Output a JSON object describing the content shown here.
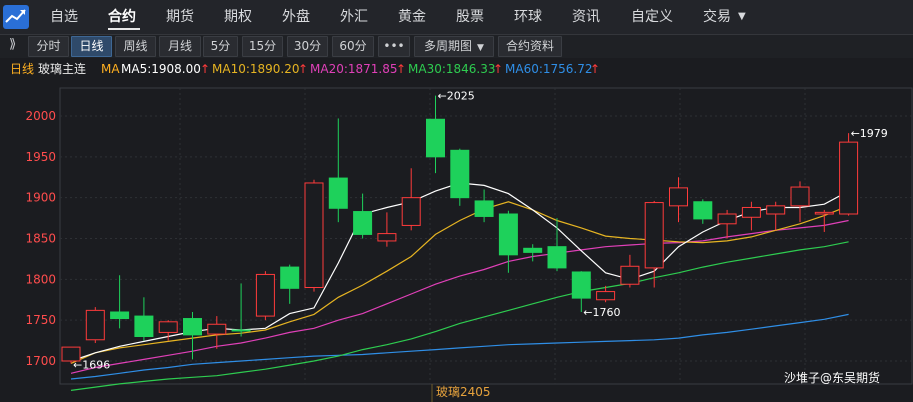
{
  "nav": {
    "items": [
      "自选",
      "合约",
      "期货",
      "期权",
      "外盘",
      "外汇",
      "黄金",
      "股票",
      "环球",
      "资讯",
      "自定义",
      "交易"
    ],
    "active_index": 1,
    "dropdown_icon": "caret-down-icon"
  },
  "toolbar": {
    "buttons": [
      "分时",
      "日线",
      "周线",
      "月线",
      "5分",
      "15分",
      "30分",
      "60分",
      "•••",
      "多周期图",
      "合约资料"
    ],
    "active_index": 1,
    "multi_period_dropdown": "caret-down-icon"
  },
  "ma_bar": {
    "period": "日线",
    "instrument": "玻璃主连",
    "ma_label": "MA",
    "ma5": "MA5:1908.00",
    "ma10": "MA10:1890.20",
    "ma20": "MA20:1871.85",
    "ma30": "MA30:1846.33",
    "ma60": "MA60:1756.72",
    "trend_arrow": "↑"
  },
  "colors": {
    "up": "#ff3b3b",
    "down": "#1ed15b",
    "ma5": "#ffffff",
    "ma10": "#e6b422",
    "ma20": "#e040b8",
    "ma30": "#2ecc50",
    "ma60": "#2f8ee6",
    "axis_text": "#ff4d4d",
    "accent": "#e6a23c"
  },
  "chart_data": {
    "type": "candlestick",
    "ylim": [
      1680,
      2025
    ],
    "yticks": [
      1700,
      1750,
      1800,
      1850,
      1900,
      1950,
      2000
    ],
    "grid": true,
    "candles": [
      {
        "o": 1700,
        "h": 1712,
        "l": 1697,
        "c": 1717
      },
      {
        "o": 1726,
        "h": 1766,
        "l": 1722,
        "c": 1762
      },
      {
        "o": 1760,
        "h": 1805,
        "l": 1740,
        "c": 1752
      },
      {
        "o": 1755,
        "h": 1778,
        "l": 1725,
        "c": 1730
      },
      {
        "o": 1735,
        "h": 1750,
        "l": 1725,
        "c": 1748
      },
      {
        "o": 1752,
        "h": 1760,
        "l": 1702,
        "c": 1732
      },
      {
        "o": 1733,
        "h": 1755,
        "l": 1715,
        "c": 1745
      },
      {
        "o": 1738,
        "h": 1795,
        "l": 1730,
        "c": 1737
      },
      {
        "o": 1755,
        "h": 1810,
        "l": 1750,
        "c": 1806
      },
      {
        "o": 1815,
        "h": 1818,
        "l": 1770,
        "c": 1789
      },
      {
        "o": 1790,
        "h": 1922,
        "l": 1785,
        "c": 1918
      },
      {
        "o": 1924,
        "h": 1997,
        "l": 1870,
        "c": 1887
      },
      {
        "o": 1883,
        "h": 1905,
        "l": 1850,
        "c": 1855
      },
      {
        "o": 1847,
        "h": 1882,
        "l": 1840,
        "c": 1856
      },
      {
        "o": 1866,
        "h": 1936,
        "l": 1860,
        "c": 1900
      },
      {
        "o": 1996,
        "h": 2025,
        "l": 1930,
        "c": 1950
      },
      {
        "o": 1958,
        "h": 1960,
        "l": 1890,
        "c": 1900
      },
      {
        "o": 1896,
        "h": 1910,
        "l": 1870,
        "c": 1877
      },
      {
        "o": 1880,
        "h": 1884,
        "l": 1808,
        "c": 1830
      },
      {
        "o": 1838,
        "h": 1843,
        "l": 1822,
        "c": 1833
      },
      {
        "o": 1840,
        "h": 1875,
        "l": 1810,
        "c": 1814
      },
      {
        "o": 1809,
        "h": 1810,
        "l": 1760,
        "c": 1777
      },
      {
        "o": 1775,
        "h": 1792,
        "l": 1772,
        "c": 1785
      },
      {
        "o": 1794,
        "h": 1830,
        "l": 1790,
        "c": 1816
      },
      {
        "o": 1814,
        "h": 1896,
        "l": 1790,
        "c": 1894
      },
      {
        "o": 1890,
        "h": 1925,
        "l": 1870,
        "c": 1912
      },
      {
        "o": 1895,
        "h": 1898,
        "l": 1868,
        "c": 1874
      },
      {
        "o": 1868,
        "h": 1885,
        "l": 1850,
        "c": 1880
      },
      {
        "o": 1876,
        "h": 1895,
        "l": 1860,
        "c": 1888
      },
      {
        "o": 1880,
        "h": 1895,
        "l": 1860,
        "c": 1890
      },
      {
        "o": 1890,
        "h": 1920,
        "l": 1870,
        "c": 1913
      },
      {
        "o": 1880,
        "h": 1885,
        "l": 1858,
        "c": 1882
      },
      {
        "o": 1880,
        "h": 1979,
        "l": 1878,
        "c": 1968
      }
    ],
    "ma5": [
      1700,
      1710,
      1718,
      1724,
      1730,
      1736,
      1740,
      1738,
      1740,
      1758,
      1765,
      1820,
      1880,
      1888,
      1895,
      1908,
      1918,
      1915,
      1905,
      1885,
      1863,
      1835,
      1808,
      1800,
      1810,
      1840,
      1858,
      1872,
      1883,
      1888,
      1888,
      1892,
      1908
    ],
    "ma10": [
      1697,
      1710,
      1716,
      1720,
      1724,
      1728,
      1732,
      1734,
      1738,
      1748,
      1757,
      1778,
      1793,
      1810,
      1828,
      1855,
      1872,
      1886,
      1895,
      1885,
      1872,
      1863,
      1853,
      1850,
      1848,
      1846,
      1845,
      1847,
      1852,
      1860,
      1868,
      1878,
      1890
    ],
    "ma20": [
      1685,
      1692,
      1697,
      1702,
      1707,
      1712,
      1718,
      1722,
      1728,
      1735,
      1740,
      1750,
      1758,
      1770,
      1782,
      1794,
      1804,
      1812,
      1822,
      1828,
      1832,
      1836,
      1840,
      1842,
      1844,
      1845,
      1847,
      1852,
      1856,
      1860,
      1863,
      1866,
      1872
    ],
    "ma30": [
      1664,
      1668,
      1672,
      1675,
      1678,
      1680,
      1682,
      1686,
      1690,
      1695,
      1700,
      1706,
      1714,
      1720,
      1727,
      1736,
      1746,
      1754,
      1762,
      1770,
      1778,
      1785,
      1790,
      1795,
      1802,
      1808,
      1815,
      1821,
      1826,
      1831,
      1836,
      1840,
      1846
    ],
    "ma60": [
      1678,
      1681,
      1685,
      1689,
      1692,
      1696,
      1698,
      1700,
      1702,
      1704,
      1706,
      1707,
      1708,
      1710,
      1712,
      1714,
      1716,
      1718,
      1720,
      1721,
      1722,
      1723,
      1724,
      1725,
      1726,
      1728,
      1732,
      1735,
      1739,
      1743,
      1747,
      1751,
      1757
    ],
    "annotations": [
      {
        "label": "←1696",
        "index": 0,
        "value": 1696
      },
      {
        "label": "←2025",
        "index": 15,
        "value": 2025
      },
      {
        "label": "←1760",
        "index": 21,
        "value": 1760
      },
      {
        "label": "←1979",
        "index": 32,
        "value": 1979
      }
    ],
    "contract_label": "玻璃2405",
    "watermark": "沙堆子@东吴期货"
  }
}
